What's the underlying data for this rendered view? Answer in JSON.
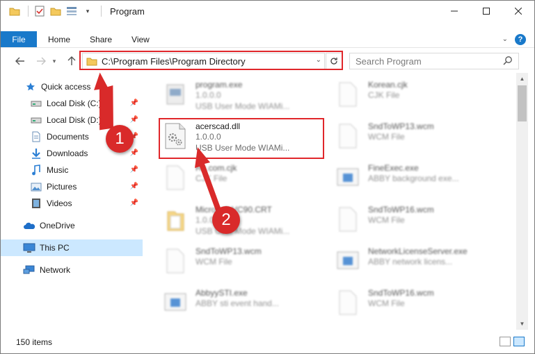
{
  "window": {
    "title": "Program"
  },
  "ribbon": {
    "tabs": [
      "File",
      "Home",
      "Share",
      "View"
    ]
  },
  "address": {
    "path": "C:\\Program Files\\Program Directory"
  },
  "search": {
    "placeholder": "Search Program"
  },
  "sidebar": {
    "items": [
      {
        "label": "Quick access",
        "icon": "star-icon",
        "pinned": false
      },
      {
        "label": "Local Disk (C:)",
        "icon": "drive-icon",
        "pinned": true
      },
      {
        "label": "Local Disk (D:)",
        "icon": "drive-icon",
        "pinned": true
      },
      {
        "label": "Documents",
        "icon": "documents-icon",
        "pinned": true
      },
      {
        "label": "Downloads",
        "icon": "downloads-icon",
        "pinned": true
      },
      {
        "label": "Music",
        "icon": "music-icon",
        "pinned": true
      },
      {
        "label": "Pictures",
        "icon": "pictures-icon",
        "pinned": true
      },
      {
        "label": "Videos",
        "icon": "videos-icon",
        "pinned": true
      },
      {
        "label": "OneDrive",
        "icon": "onedrive-icon",
        "pinned": false
      },
      {
        "label": "This PC",
        "icon": "this-pc-icon",
        "pinned": false,
        "selected": true
      },
      {
        "label": "Network",
        "icon": "network-icon",
        "pinned": false
      }
    ]
  },
  "files": {
    "left": [
      {
        "name": "program.exe",
        "line2": "1.0.0.0",
        "line3": "USB User Mode WIAMi...",
        "icon": "exe-icon"
      },
      {
        "name": "acerscad.dll",
        "line2": "1.0.0.0",
        "line3": "USB User Mode WIAMi...",
        "icon": "dll-icon",
        "highlighted": true
      },
      {
        "name": "Ru.com.cjk",
        "line2": "CJK File",
        "line3": "",
        "icon": "file-icon"
      },
      {
        "name": "Microsoft.VC90.CRT",
        "line2": "1.0.0.0",
        "line3": "USB User Mode WIAMi...",
        "icon": "folder-icon"
      },
      {
        "name": "SndToWP13.wcm",
        "line2": "WCM File",
        "line3": "",
        "icon": "file-icon"
      },
      {
        "name": "AbbyySTI.exe",
        "line2": "ABBY sti event hand...",
        "line3": "",
        "icon": "app-icon"
      }
    ],
    "right": [
      {
        "name": "Korean.cjk",
        "line2": "CJK File",
        "icon": "file-icon"
      },
      {
        "name": "SndToWP13.wcm",
        "line2": "WCM File",
        "icon": "file-icon"
      },
      {
        "name": "FineExec.exe",
        "line2": "ABBY background exe...",
        "icon": "app-icon"
      },
      {
        "name": "SndToWP16.wcm",
        "line2": "WCM File",
        "icon": "file-icon"
      },
      {
        "name": "NetworkLicenseServer.exe",
        "line2": "ABBY network licens...",
        "icon": "app-icon"
      },
      {
        "name": "SndToWP16.wcm",
        "line2": "WCM File",
        "icon": "file-icon"
      }
    ]
  },
  "status": {
    "count": "150 items"
  },
  "annotations": {
    "step1": "1",
    "step2": "2",
    "color": "#d92a2a"
  }
}
